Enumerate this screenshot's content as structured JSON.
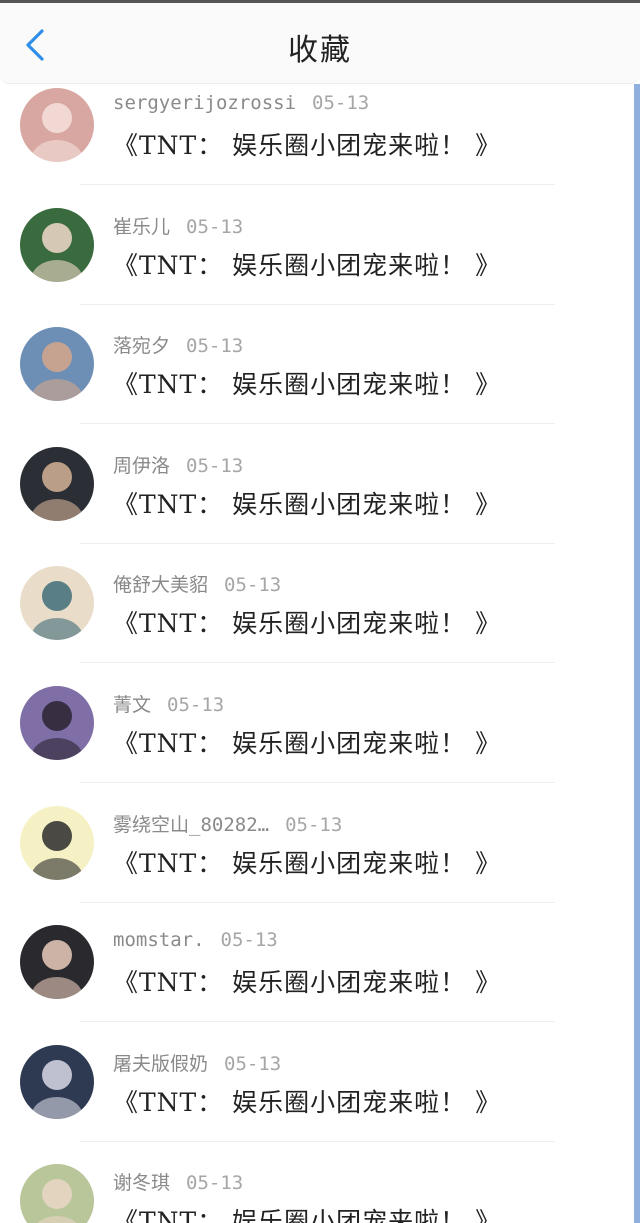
{
  "header": {
    "title": "收藏",
    "back_icon": "chevron-left-icon"
  },
  "colors": {
    "accent": "#2f8fe8"
  },
  "items": [
    {
      "user": "sergyerijozrossi",
      "date": "05-13",
      "text": "《TNT： 娱乐圈小团宠来啦！ 》",
      "avatar_bg": "#d9a7a1",
      "avatar_fg": "#f4e0dc"
    },
    {
      "user": "崔乐儿",
      "date": "05-13",
      "text": "《TNT： 娱乐圈小团宠来啦！ 》",
      "avatar_bg": "#3a6b3f",
      "avatar_fg": "#f1d8c9"
    },
    {
      "user": "落宛夕",
      "date": "05-13",
      "text": "《TNT： 娱乐圈小团宠来啦！ 》",
      "avatar_bg": "#6d8fb6",
      "avatar_fg": "#d6a78b"
    },
    {
      "user": "周伊洛",
      "date": "05-13",
      "text": "《TNT： 娱乐圈小团宠来啦！ 》",
      "avatar_bg": "#2b2f35",
      "avatar_fg": "#d4b296"
    },
    {
      "user": "俺舒大美貂",
      "date": "05-13",
      "text": "《TNT： 娱乐圈小团宠来啦！ 》",
      "avatar_bg": "#e9ddc9",
      "avatar_fg": "#3f6d7a"
    },
    {
      "user": "菁文",
      "date": "05-13",
      "text": "《TNT： 娱乐圈小团宠来啦！ 》",
      "avatar_bg": "#7f6fa6",
      "avatar_fg": "#2a2330"
    },
    {
      "user": "雾绕空山_80282…",
      "date": "05-13",
      "text": "《TNT： 娱乐圈小团宠来啦！ 》",
      "avatar_bg": "#f5f1c5",
      "avatar_fg": "#2c2c2c"
    },
    {
      "user": "momstar.",
      "date": "05-13",
      "text": "《TNT： 娱乐圈小团宠来啦！ 》",
      "avatar_bg": "#2a2a2e",
      "avatar_fg": "#e9cbbb"
    },
    {
      "user": "屠夫版假奶",
      "date": "05-13",
      "text": "《TNT： 娱乐圈小团宠来啦！ 》",
      "avatar_bg": "#2e3a52",
      "avatar_fg": "#d8d8e6"
    },
    {
      "user": "谢冬琪",
      "date": "05-13",
      "text": "《TNT： 娱乐圈小团宠来啦！ 》",
      "avatar_bg": "#b8c69a",
      "avatar_fg": "#e9d6c6"
    }
  ]
}
